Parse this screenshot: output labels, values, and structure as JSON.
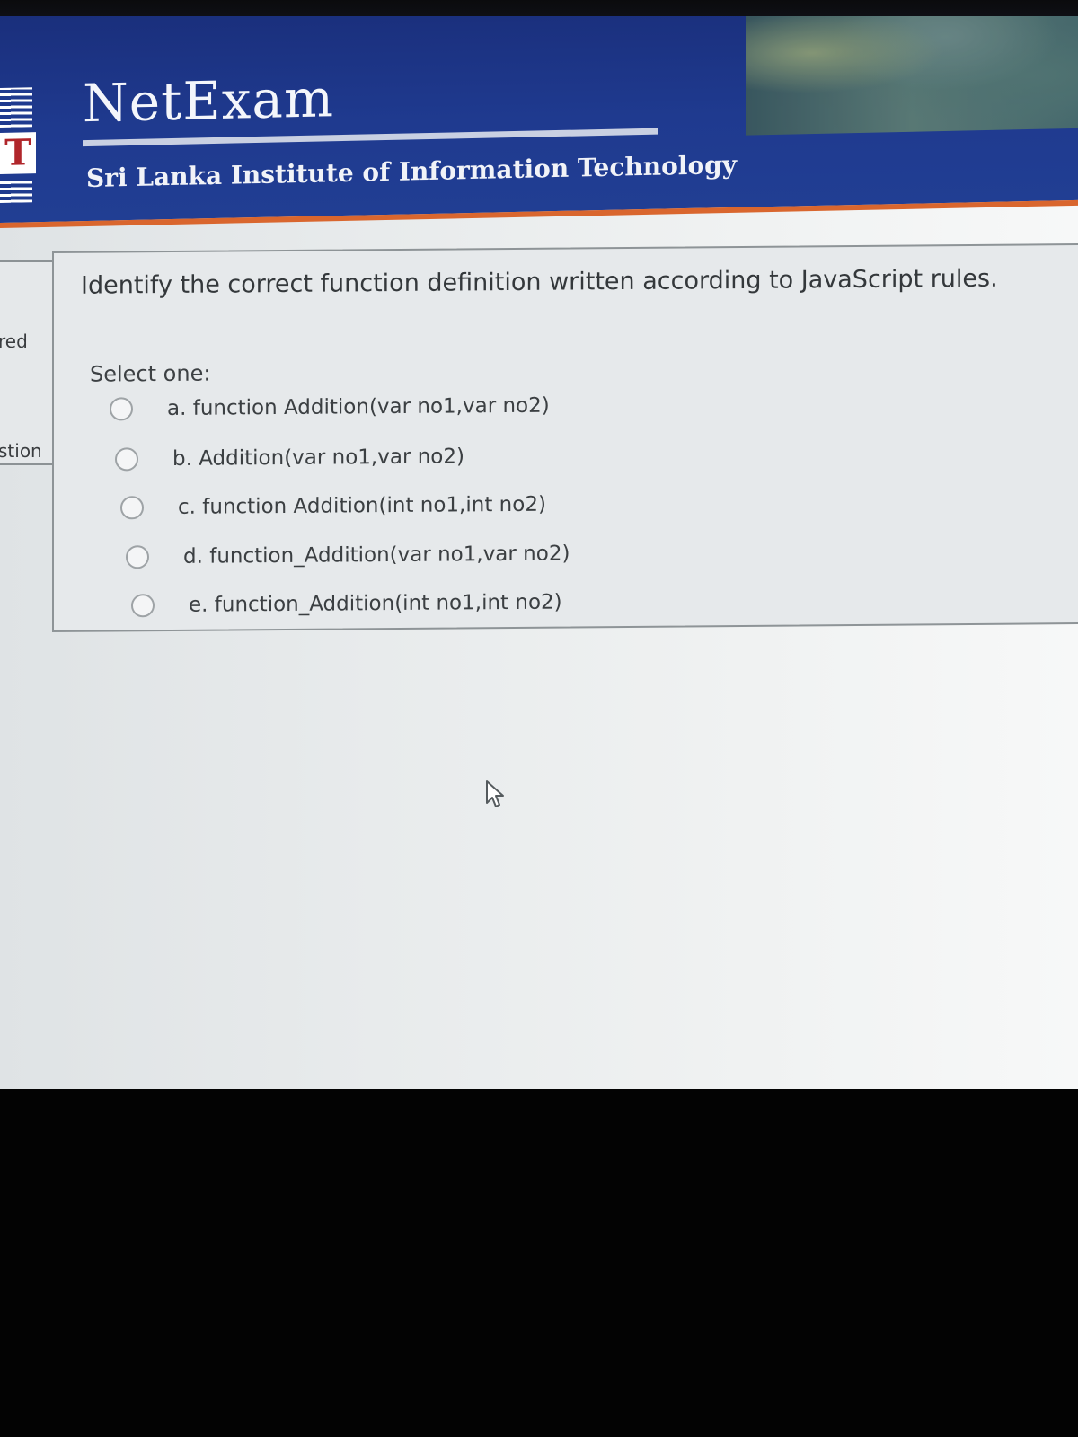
{
  "header": {
    "brand": "NetExam",
    "institute": "Sri Lanka Institute of Information Technology",
    "logo_letter": "T"
  },
  "sidebar": {
    "label_1": "red",
    "label_2": "stion"
  },
  "question": {
    "text": "Identify the correct function definition written according to JavaScript rules.",
    "select_label": "Select one:",
    "options": [
      {
        "label": "a. function Addition(var no1,var no2)",
        "selected": false
      },
      {
        "label": "b. Addition(var no1,var no2)",
        "selected": false
      },
      {
        "label": "c. function Addition(int no1,int no2)",
        "selected": false
      },
      {
        "label": "d. function_Addition(var no1,var no2)",
        "selected": false
      },
      {
        "label": "e. function_Addition(int no1,int no2)",
        "selected": false
      }
    ]
  },
  "colors": {
    "header_blue": "#1f3a8f",
    "header_accent": "#d9662e",
    "page_background": "#e8ebec"
  }
}
